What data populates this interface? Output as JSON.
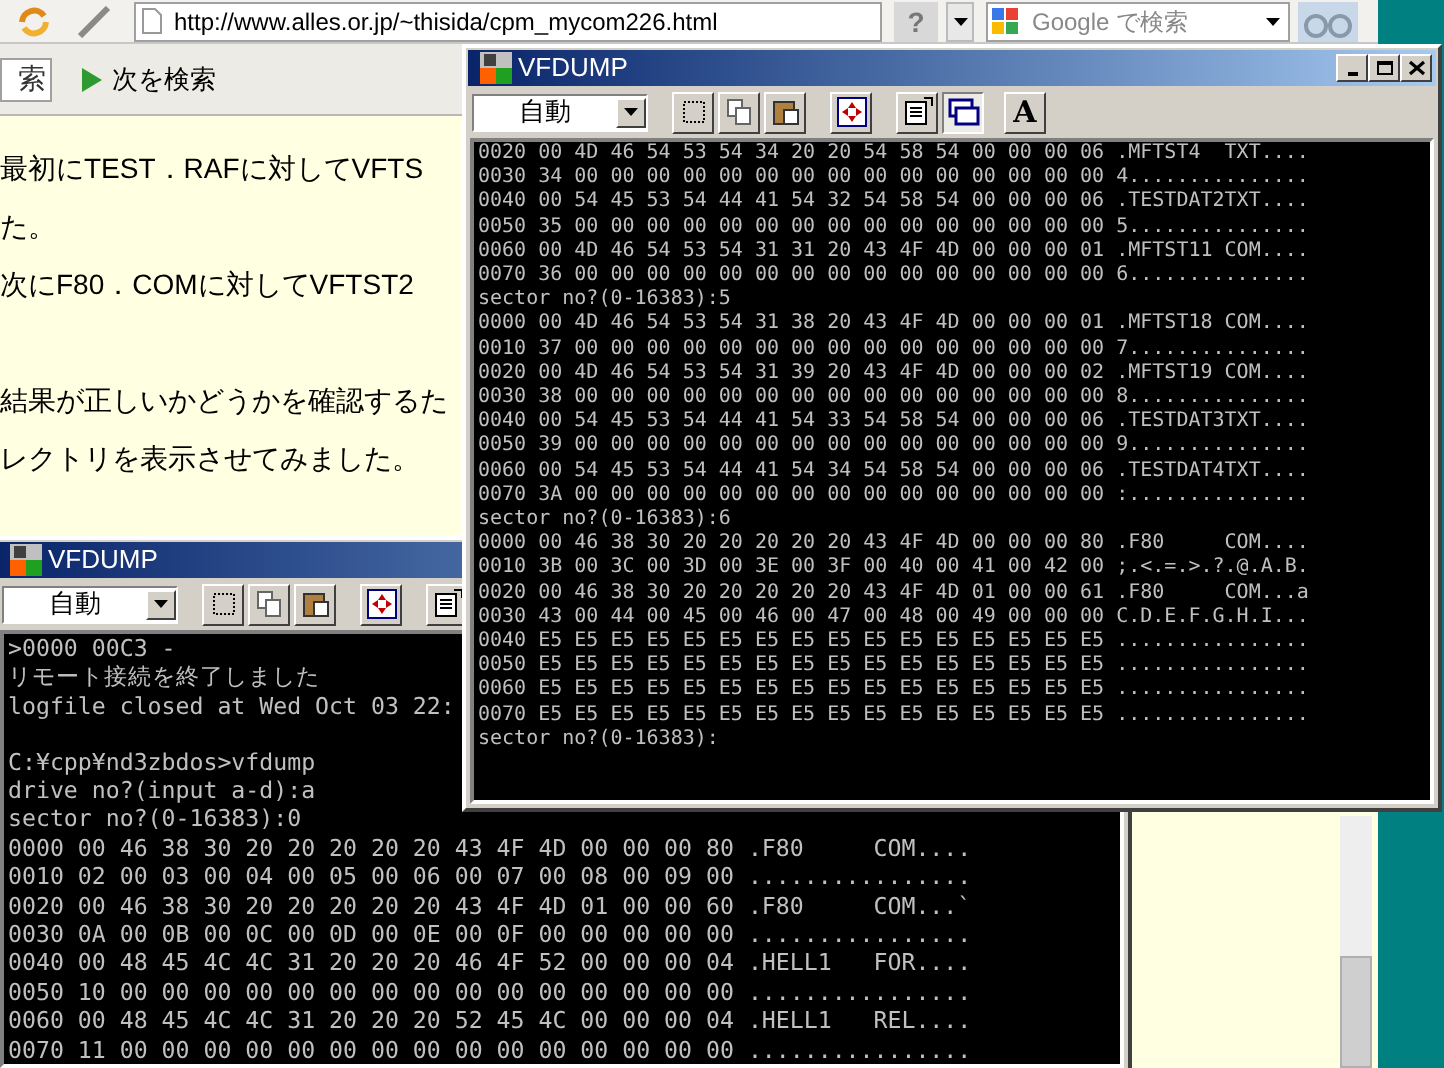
{
  "browser": {
    "url": "http://www.alles.or.jp/~thisida/cpm_mycom226.html",
    "help": "?",
    "search_placeholder": "Google で検索",
    "find_field": "索",
    "find_next": "次を検索",
    "paragraphs": [
      {
        "lines": [
          "最初にTEST．RAFに対してVFTS",
          "た。",
          "次にF80．COMに対してVFTST2"
        ]
      },
      {
        "lines": [
          "結果が正しいかどうかを確認するた",
          "レクトリを表示させてみました。"
        ]
      }
    ]
  },
  "windows": [
    {
      "title": "VFDUMP",
      "font_mode": "自動",
      "toolbar": [
        {
          "kind": "mark",
          "pressed": false
        },
        {
          "kind": "copy",
          "pressed": false
        },
        {
          "kind": "paste",
          "pressed": false
        },
        {
          "kind": "fullscreen",
          "pressed": false
        },
        {
          "kind": "properties",
          "pressed": false
        }
      ],
      "console": [
        {
          "lines": [
            ">0000 00C3 -",
            "リモート接続を終了しました",
            "logfile closed at Wed Oct 03 22:"
          ]
        },
        {
          "lines": [
            "C:¥cpp¥nd3zbdos>vfdump",
            "drive no?(input a-d):a",
            "sector no?(0-16383):0",
            "0000 00 46 38 30 20 20 20 20 20 43 4F 4D 00 00 00 80 .F80     COM....",
            "0010 02 00 03 00 04 00 05 00 06 00 07 00 08 00 09 00 ................",
            "0020 00 46 38 30 20 20 20 20 20 43 4F 4D 01 00 00 60 .F80     COM...`",
            "0030 0A 00 0B 00 0C 00 0D 00 0E 00 0F 00 00 00 00 00 ................",
            "0040 00 48 45 4C 4C 31 20 20 20 46 4F 52 00 00 00 04 .HELL1   FOR....",
            "0050 10 00 00 00 00 00 00 00 00 00 00 00 00 00 00 00 ................",
            "0060 00 48 45 4C 4C 31 20 20 20 52 45 4C 00 00 00 04 .HELL1   REL....",
            "0070 11 00 00 00 00 00 00 00 00 00 00 00 00 00 00 00 ................"
          ]
        }
      ]
    },
    {
      "title": "VFDUMP",
      "font_mode": "自動",
      "toolbar": [
        {
          "kind": "mark",
          "pressed": false
        },
        {
          "kind": "copy",
          "pressed": false
        },
        {
          "kind": "paste",
          "pressed": false
        },
        {
          "kind": "fullscreen",
          "pressed": false
        },
        {
          "kind": "properties",
          "pressed": false
        },
        {
          "kind": "background",
          "pressed": true
        },
        {
          "kind": "font",
          "glyph": "A",
          "pressed": false
        }
      ],
      "console": [
        {
          "lines": [
            "0020 00 4D 46 54 53 54 34 20 20 54 58 54 00 00 00 06 .MFTST4  TXT....",
            "0030 34 00 00 00 00 00 00 00 00 00 00 00 00 00 00 00 4...............",
            "0040 00 54 45 53 54 44 41 54 32 54 58 54 00 00 00 06 .TESTDAT2TXT....",
            "0050 35 00 00 00 00 00 00 00 00 00 00 00 00 00 00 00 5...............",
            "0060 00 4D 46 54 53 54 31 31 20 43 4F 4D 00 00 00 01 .MFTST11 COM....",
            "0070 36 00 00 00 00 00 00 00 00 00 00 00 00 00 00 00 6...............",
            "sector no?(0-16383):5",
            "0000 00 4D 46 54 53 54 31 38 20 43 4F 4D 00 00 00 01 .MFTST18 COM....",
            "0010 37 00 00 00 00 00 00 00 00 00 00 00 00 00 00 00 7...............",
            "0020 00 4D 46 54 53 54 31 39 20 43 4F 4D 00 00 00 02 .MFTST19 COM....",
            "0030 38 00 00 00 00 00 00 00 00 00 00 00 00 00 00 00 8...............",
            "0040 00 54 45 53 54 44 41 54 33 54 58 54 00 00 00 06 .TESTDAT3TXT....",
            "0050 39 00 00 00 00 00 00 00 00 00 00 00 00 00 00 00 9...............",
            "0060 00 54 45 53 54 44 41 54 34 54 58 54 00 00 00 06 .TESTDAT4TXT....",
            "0070 3A 00 00 00 00 00 00 00 00 00 00 00 00 00 00 00 :...............",
            "sector no?(0-16383):6",
            "0000 00 46 38 30 20 20 20 20 20 43 4F 4D 00 00 00 80 .F80     COM....",
            "0010 3B 00 3C 00 3D 00 3E 00 3F 00 40 00 41 00 42 00 ;.<.=.>.?.@.A.B.",
            "0020 00 46 38 30 20 20 20 20 20 43 4F 4D 01 00 00 61 .F80     COM...a",
            "0030 43 00 44 00 45 00 46 00 47 00 48 00 49 00 00 00 C.D.E.F.G.H.I...",
            "0040 E5 E5 E5 E5 E5 E5 E5 E5 E5 E5 E5 E5 E5 E5 E5 E5 ................",
            "0050 E5 E5 E5 E5 E5 E5 E5 E5 E5 E5 E5 E5 E5 E5 E5 E5 ................",
            "0060 E5 E5 E5 E5 E5 E5 E5 E5 E5 E5 E5 E5 E5 E5 E5 E5 ................",
            "0070 E5 E5 E5 E5 E5 E5 E5 E5 E5 E5 E5 E5 E5 E5 E5 E5 ................",
            "sector no?(0-16383):"
          ]
        }
      ]
    }
  ]
}
